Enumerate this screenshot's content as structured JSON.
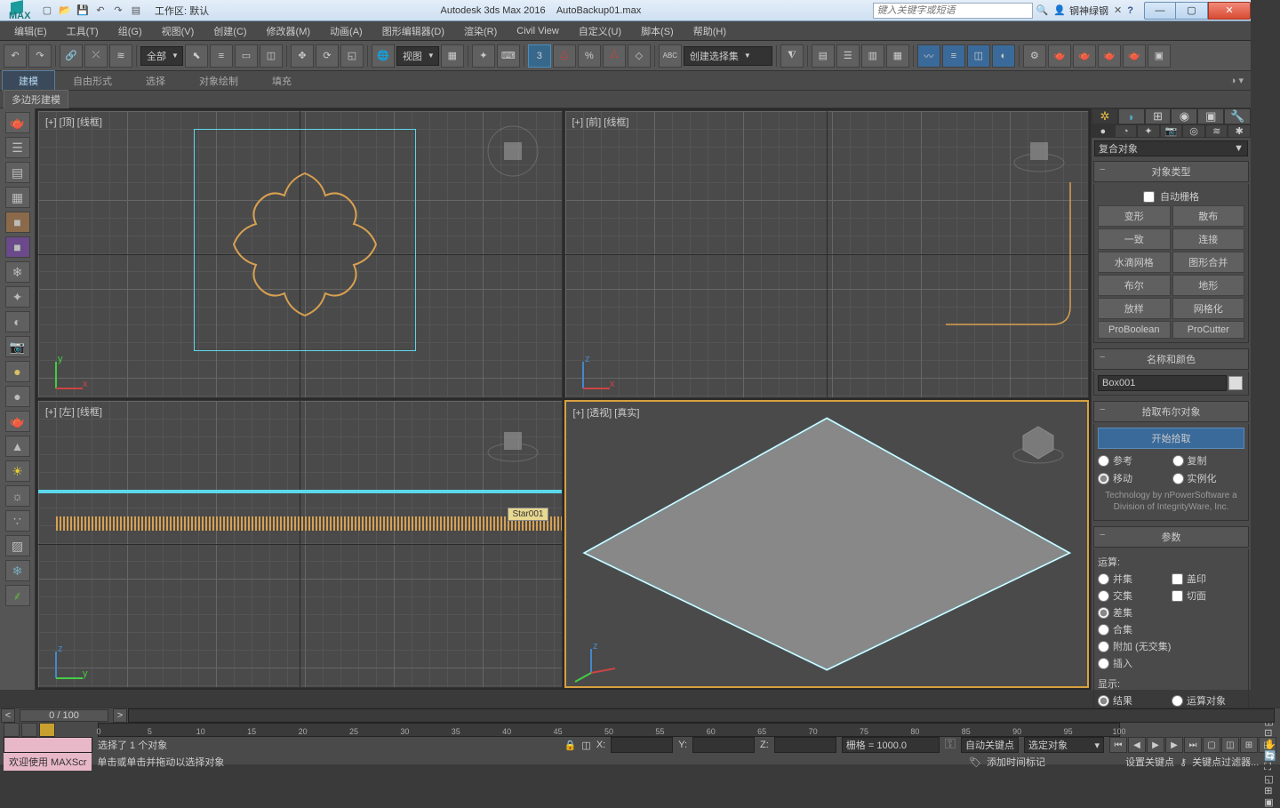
{
  "title": {
    "app": "Autodesk 3ds Max 2016",
    "file": "AutoBackup01.max",
    "workspace": "工作区: 默认",
    "user": "钢神绿钢",
    "search_placeholder": "键入关键字或短语"
  },
  "menu": [
    "编辑(E)",
    "工具(T)",
    "组(G)",
    "视图(V)",
    "创建(C)",
    "修改器(M)",
    "动画(A)",
    "图形编辑器(D)",
    "渲染(R)",
    "Civil View",
    "自定义(U)",
    "脚本(S)",
    "帮助(H)"
  ],
  "toolbar": {
    "combo_all": "全部",
    "combo_view": "视图",
    "combo_sel": "创建选择集",
    "snap_num": "3"
  },
  "ribbon": {
    "tabs": [
      "建模",
      "自由形式",
      "选择",
      "对象绘制",
      "填充"
    ],
    "sub": "多边形建模"
  },
  "viewports": {
    "top": "[+] [顶] [线框]",
    "front": "[+] [前] [线框]",
    "left": "[+] [左] [线框]",
    "persp": "[+] [透视] [真实]",
    "obj_label": "Star001"
  },
  "panel": {
    "category": "复合对象",
    "roll_type": "对象类型",
    "autogrid": "自动栅格",
    "types": [
      "变形",
      "散布",
      "一致",
      "连接",
      "水滴网格",
      "图形合并",
      "布尔",
      "地形",
      "放样",
      "网格化",
      "ProBoolean",
      "ProCutter"
    ],
    "roll_name": "名称和颜色",
    "name_val": "Box001",
    "roll_bool": "拾取布尔对象",
    "pick_btn": "开始拾取",
    "opts": {
      "ref": "参考",
      "copy": "复制",
      "move": "移动",
      "inst": "实例化"
    },
    "credit": "Technology by nPowerSoftware a Division of IntegrityWare, Inc.",
    "roll_param": "参数",
    "op_label": "运算:",
    "ops": {
      "union": "并集",
      "stamp": "盖印",
      "inter": "交集",
      "cookie": "切面",
      "sub": "差集",
      "merge": "合集",
      "attach": "附加 (无交集)",
      "insert": "插入"
    },
    "disp_label": "显示:",
    "disp": {
      "result": "结果",
      "operands": "运算对象"
    }
  },
  "time": {
    "frame": "0 / 100",
    "ticks": [
      0,
      5,
      10,
      15,
      20,
      25,
      30,
      35,
      40,
      45,
      50,
      55,
      60,
      65,
      70,
      75,
      80,
      85,
      90,
      95,
      100
    ]
  },
  "status": {
    "sel_msg": "选择了 1 个对象",
    "hint": "单击或单击并拖动以选择对象",
    "x": "X:",
    "y": "Y:",
    "z": "Z:",
    "grid": "栅格 = 1000.0",
    "autokey": "自动关键点",
    "selobj": "选定对象",
    "setkey": "设置关键点",
    "keyfilter": "关键点过滤器...",
    "addtag": "添加时间标记",
    "welcome": "欢迎使用  MAXScr"
  }
}
